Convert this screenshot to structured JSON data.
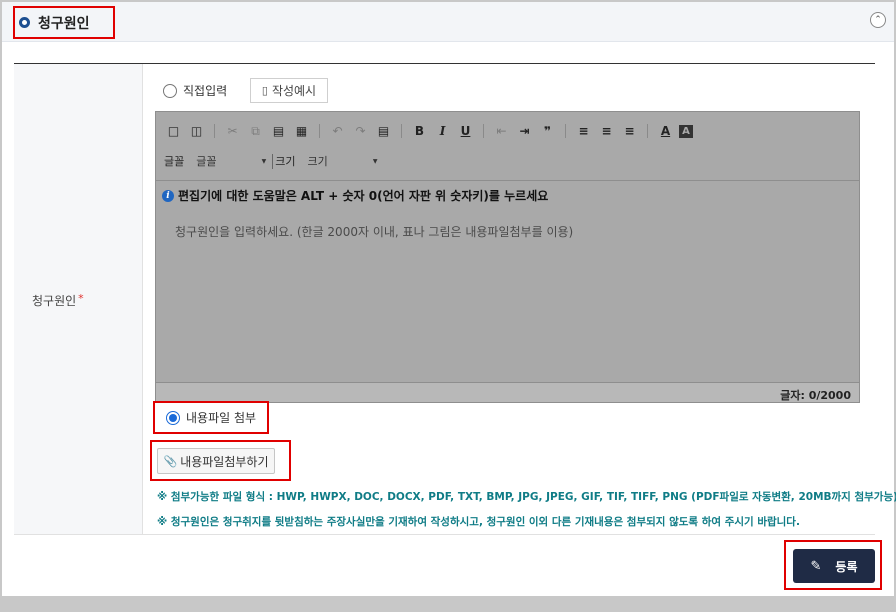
{
  "section": {
    "title": "청구원인",
    "collapse_icon": "chevron-up-icon"
  },
  "field": {
    "label": "청구원인",
    "required_mark": "*"
  },
  "input_mode": {
    "direct_label": "직접입력",
    "direct_selected": false,
    "example_button": "작성예시"
  },
  "editor": {
    "toolbar_font_label": "글꼴",
    "toolbar_font_value": "글꼴",
    "toolbar_size_label": "크기",
    "toolbar_size_value": "크기",
    "help_text": "편집기에 대한 도움말은 ALT + 숫자 0(언어 자판 위 숫자키)를 누르세요",
    "placeholder": "청구원인을 입력하세요. (한글 2000자 이내, 표나 그림은 내용파일첨부를 이용)",
    "counter": "글자: 0/2000"
  },
  "attach": {
    "radio_label": "내용파일 첨부",
    "radio_selected": true,
    "button_label": "내용파일첨부하기"
  },
  "notices": [
    "※ 첨부가능한 파일 형식 : HWP, HWPX, DOC, DOCX, PDF, TXT, BMP, JPG, JPEG, GIF, TIF, TIFF, PNG (PDF파일로 자동변환, 20MB까지 첨부가능)",
    "※ 청구원인은 청구취지를 뒷받침하는 주장사실만을 기재하여 작성하시고, 청구원인 이외 다른 기재내용은 첨부되지 않도록 하여 주시기 바랍니다."
  ],
  "submit": {
    "label": "등록"
  },
  "colors": {
    "accent": "#1f2b45",
    "notice": "#0f7c86",
    "highlight": "#e00000",
    "radio": "#1a6ad8"
  }
}
